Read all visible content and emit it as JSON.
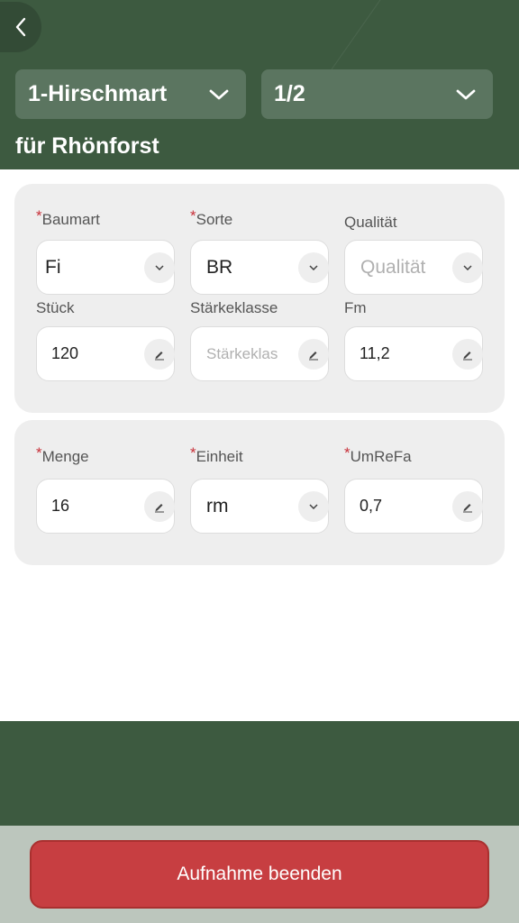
{
  "header": {
    "back_icon": "chevron-left-icon",
    "dropdown_left": {
      "value": "1-Hirschmart",
      "icon": "chevron-down-icon"
    },
    "dropdown_right": {
      "value": "1/2",
      "icon": "chevron-down-icon"
    },
    "subtitle": "für Rhönforst"
  },
  "card1": {
    "baumart": {
      "label": "Baumart",
      "required": true,
      "value": "Fi",
      "icon": "chevron-down-icon"
    },
    "sorte": {
      "label": "Sorte",
      "required": true,
      "value": "BR",
      "icon": "chevron-down-icon"
    },
    "qualitaet": {
      "label": "Qualität",
      "required": false,
      "placeholder": "Qualität",
      "icon": "chevron-down-icon"
    },
    "stueck": {
      "label": "Stück",
      "value": "120",
      "icon": "pencil-icon"
    },
    "staerkeklasse": {
      "label": "Stärkeklasse",
      "placeholder": "Stärkeklas",
      "icon": "pencil-icon"
    },
    "fm": {
      "label": "Fm",
      "value": "11,2",
      "icon": "pencil-icon"
    }
  },
  "card2": {
    "menge": {
      "label": "Menge",
      "required": true,
      "value": "16",
      "icon": "pencil-icon"
    },
    "einheit": {
      "label": "Einheit",
      "required": true,
      "value": "rm",
      "icon": "chevron-down-icon"
    },
    "umrefa": {
      "label": "UmReFa",
      "required": true,
      "value": "0,7",
      "icon": "pencil-icon"
    }
  },
  "footer": {
    "end_button": "Aufnahme beenden"
  },
  "colors": {
    "header_green": "#3d5a40",
    "required_star": "#c8313a",
    "end_button": "#c73e41"
  }
}
